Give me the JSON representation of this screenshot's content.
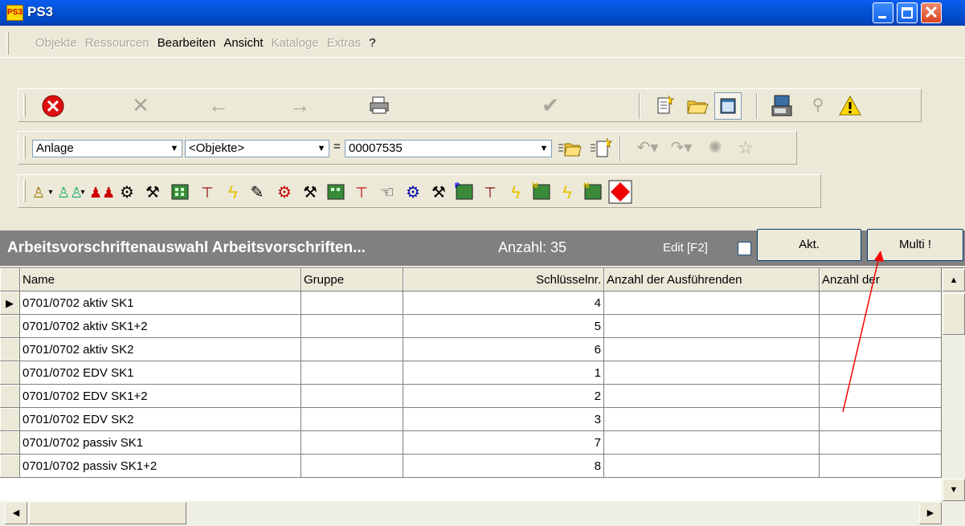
{
  "window": {
    "title": "PS3",
    "app_icon_text": "PS3"
  },
  "menu": {
    "items": [
      {
        "label": "Objekte",
        "enabled": false
      },
      {
        "label": "Ressourcen",
        "enabled": false
      },
      {
        "label": "Bearbeiten",
        "enabled": true
      },
      {
        "label": "Ansicht",
        "enabled": true
      },
      {
        "label": "Kataloge",
        "enabled": false
      },
      {
        "label": "Extras",
        "enabled": false
      },
      {
        "label": "?",
        "enabled": true
      }
    ]
  },
  "toolbar2": {
    "type_select": "Anlage",
    "object_select": "<Objekte>",
    "equals": "=",
    "id_select": "00007535"
  },
  "header": {
    "title": "Arbeitsvorschriftenauswahl Arbeitsvorschriften...",
    "count": "Anzahl: 35",
    "edit_label": "Edit [F2]",
    "akt_button": "Akt.",
    "multi_button": "Multi !"
  },
  "table": {
    "columns": [
      "Name",
      "Gruppe",
      "Schlüsselnr.",
      "Anzahl der Ausführenden",
      "Anzahl der"
    ],
    "rows": [
      {
        "name": "0701/0702 aktiv SK1",
        "gruppe": "",
        "nr": "4",
        "ausf": "",
        "anz": ""
      },
      {
        "name": "0701/0702 aktiv SK1+2",
        "gruppe": "",
        "nr": "5",
        "ausf": "",
        "anz": ""
      },
      {
        "name": "0701/0702 aktiv SK2",
        "gruppe": "",
        "nr": "6",
        "ausf": "",
        "anz": ""
      },
      {
        "name": "0701/0702 EDV SK1",
        "gruppe": "",
        "nr": "1",
        "ausf": "",
        "anz": ""
      },
      {
        "name": "0701/0702 EDV SK1+2",
        "gruppe": "",
        "nr": "2",
        "ausf": "",
        "anz": ""
      },
      {
        "name": "0701/0702 EDV SK2",
        "gruppe": "",
        "nr": "3",
        "ausf": "",
        "anz": ""
      },
      {
        "name": "0701/0702 passiv SK1",
        "gruppe": "",
        "nr": "7",
        "ausf": "",
        "anz": ""
      },
      {
        "name": "0701/0702 passiv SK1+2",
        "gruppe": "",
        "nr": "8",
        "ausf": "",
        "anz": ""
      }
    ]
  },
  "colors": {
    "titlebar": "#0453d6",
    "header_bar": "#808080",
    "annotation_arrow": "#ff0000"
  }
}
